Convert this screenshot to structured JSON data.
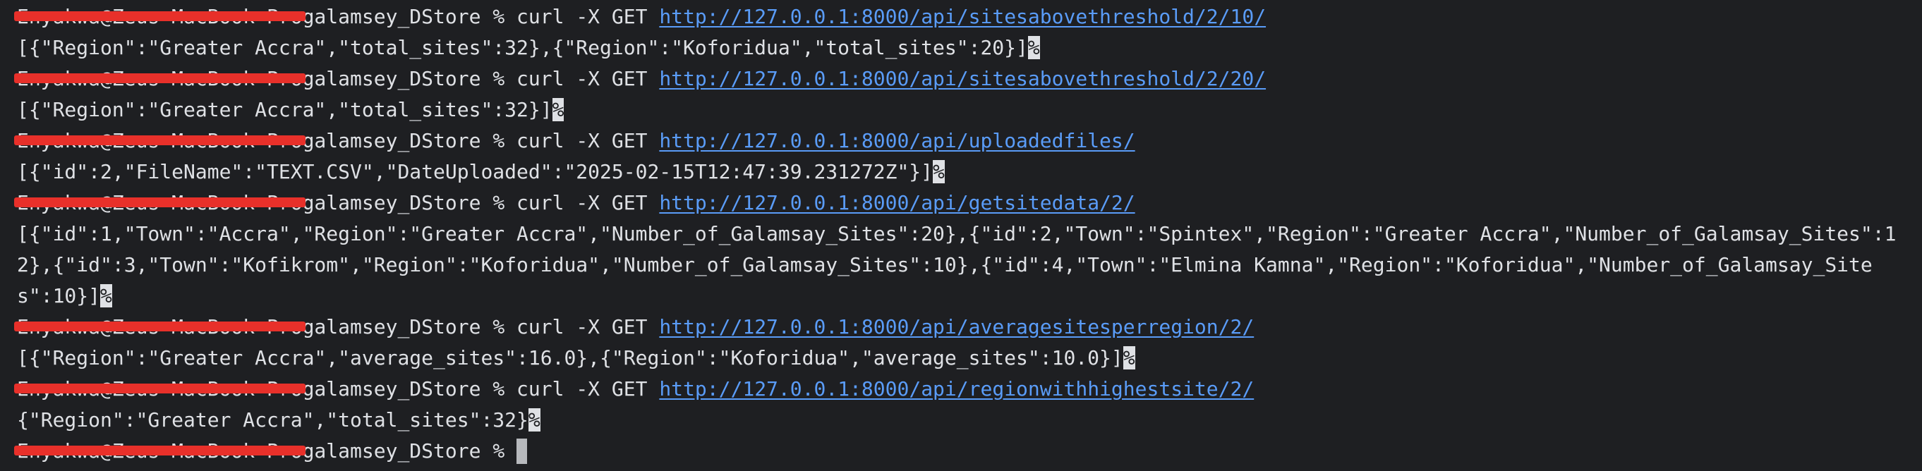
{
  "prompt": {
    "user_host": "Enyakwa@Zeus-MacBook-Pro",
    "directory": "galamsey_DStore",
    "symbol": "%"
  },
  "eol_marker": "%",
  "entries": [
    {
      "command": "curl -X GET",
      "url": "http://127.0.0.1:8000/api/sitesabovethreshold/2/10/",
      "output": "[{\"Region\":\"Greater Accra\",\"total_sites\":32},{\"Region\":\"Koforidua\",\"total_sites\":20}]"
    },
    {
      "command": "curl -X GET",
      "url": "http://127.0.0.1:8000/api/sitesabovethreshold/2/20/",
      "output": "[{\"Region\":\"Greater Accra\",\"total_sites\":32}]"
    },
    {
      "command": "curl -X GET",
      "url": "http://127.0.0.1:8000/api/uploadedfiles/",
      "output": "[{\"id\":2,\"FileName\":\"TEXT.CSV\",\"DateUploaded\":\"2025-02-15T12:47:39.231272Z\"}]"
    },
    {
      "command": "curl -X GET",
      "url": "http://127.0.0.1:8000/api/getsitedata/2/",
      "output": "[{\"id\":1,\"Town\":\"Accra\",\"Region\":\"Greater Accra\",\"Number_of_Galamsay_Sites\":20},{\"id\":2,\"Town\":\"Spintex\",\"Region\":\"Greater Accra\",\"Number_of_Galamsay_Sites\":12},{\"id\":3,\"Town\":\"Kofikrom\",\"Region\":\"Koforidua\",\"Number_of_Galamsay_Sites\":10},{\"id\":4,\"Town\":\"Elmina Kamna\",\"Region\":\"Koforidua\",\"Number_of_Galamsay_Sites\":10}]"
    },
    {
      "command": "curl -X GET",
      "url": "http://127.0.0.1:8000/api/averagesitesperregion/2/",
      "output": "[{\"Region\":\"Greater Accra\",\"average_sites\":16.0},{\"Region\":\"Koforidua\",\"average_sites\":10.0}]"
    },
    {
      "command": "curl -X GET",
      "url": "http://127.0.0.1:8000/api/regionwithhighestsite/2/",
      "output": "{\"Region\":\"Greater Accra\",\"total_sites\":32}"
    }
  ],
  "colors": {
    "background": "#1e1f22",
    "text": "#dfe1e5",
    "link": "#5a9cf8",
    "redaction": "#e8302a"
  }
}
